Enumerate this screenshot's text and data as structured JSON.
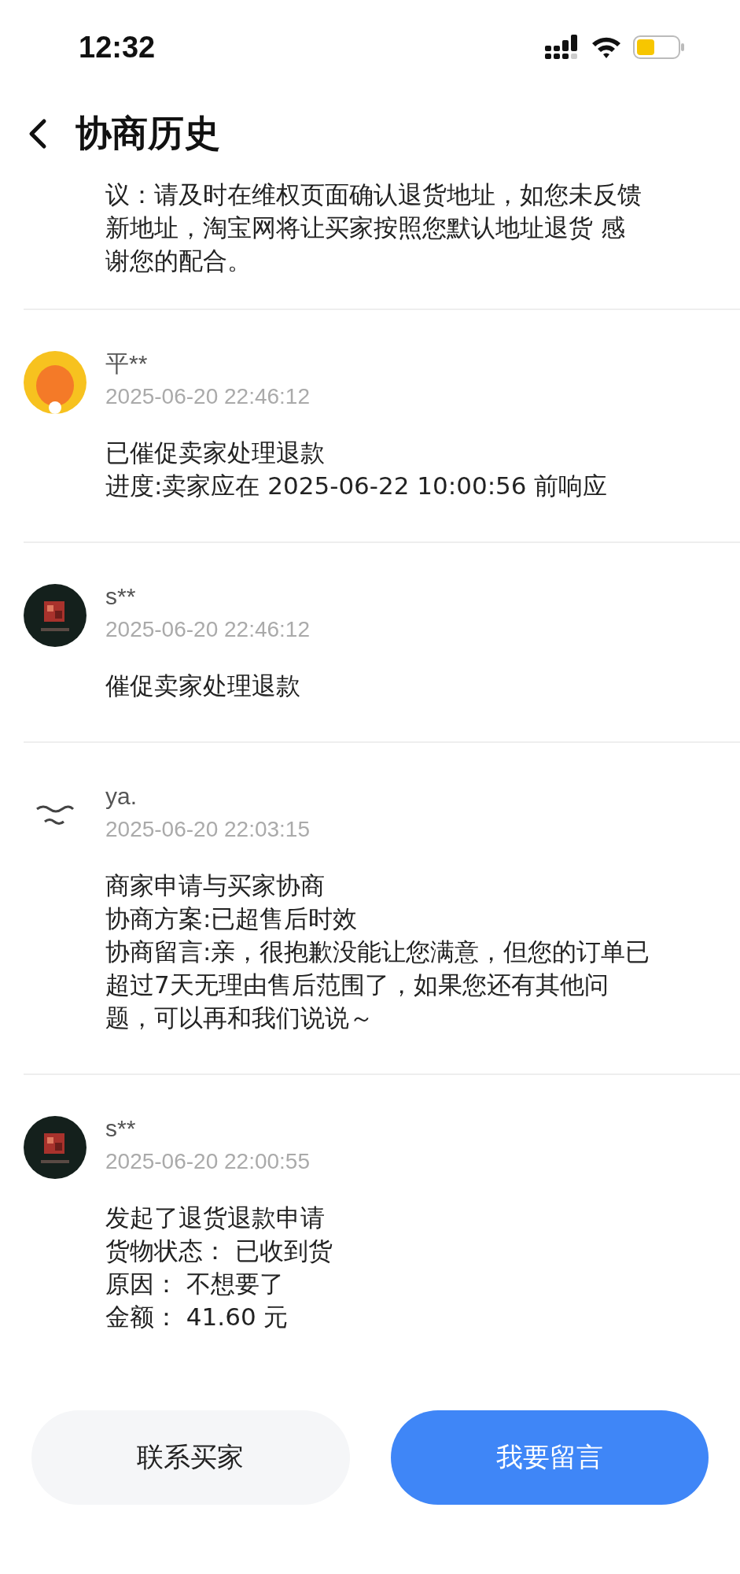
{
  "status_bar": {
    "time": "12:32"
  },
  "header": {
    "title": "协商历史"
  },
  "entries": [
    {
      "kind": "continued",
      "lines": [
        "议：请及时在维权页面确认退货地址，如您未反馈",
        "新地址，淘宝网将让买家按照您默认地址退货  感",
        "谢您的配合。"
      ]
    },
    {
      "kind": "message",
      "avatar": {
        "kind": "mascot"
      },
      "name": "平**",
      "time": "2025-06-20 22:46:12",
      "lines": [
        "已催促卖家处理退款",
        "进度:卖家应在 2025-06-22 10:00:56 前响应"
      ]
    },
    {
      "kind": "message",
      "avatar": {
        "kind": "dark"
      },
      "name": "s**",
      "time": "2025-06-20 22:46:12",
      "lines": [
        "催促卖家处理退款"
      ]
    },
    {
      "kind": "message",
      "avatar": {
        "kind": "script"
      },
      "name": "ya.",
      "time": "2025-06-20 22:03:15",
      "lines": [
        "商家申请与买家协商",
        "协商方案:已超售后时效",
        "协商留言:亲，很抱歉没能让您满意，但您的订单已",
        "超过7天无理由售后范围了，如果您还有其他问",
        "题，可以再和我们说说～"
      ]
    },
    {
      "kind": "message",
      "avatar": {
        "kind": "dark"
      },
      "name": "s**",
      "time": "2025-06-20 22:00:55",
      "lines": [
        "发起了退货退款申请",
        "货物状态： 已收到货",
        "原因： 不想要了",
        "金额： 41.60 元"
      ]
    }
  ],
  "buttons": [
    {
      "label": "联系买家",
      "kind": "secondary"
    },
    {
      "label": "我要留言",
      "kind": "primary"
    }
  ]
}
